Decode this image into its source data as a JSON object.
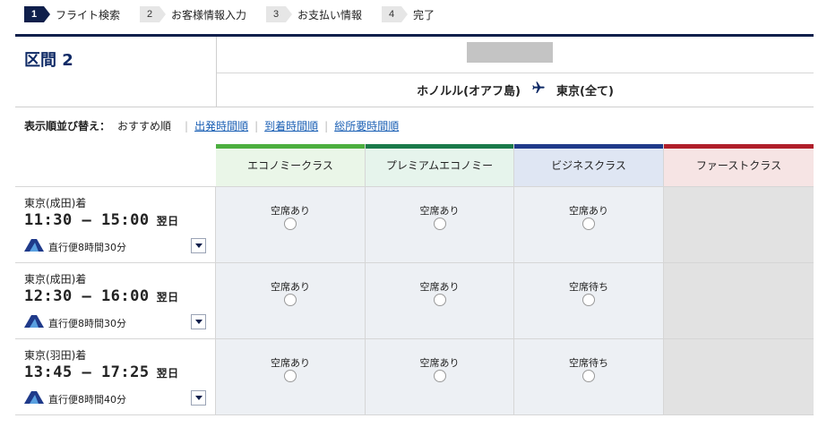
{
  "stepper": [
    {
      "num": "1",
      "label": "フライト検索",
      "active": true
    },
    {
      "num": "2",
      "label": "お客様情報入力",
      "active": false
    },
    {
      "num": "3",
      "label": "お支払い情報",
      "active": false
    },
    {
      "num": "4",
      "label": "完了",
      "active": false
    }
  ],
  "section": {
    "title": "区間 2"
  },
  "route": {
    "origin": "ホノルル(オアフ島)",
    "destination": "東京(全て)",
    "plane_icon": "airplane-icon"
  },
  "sort": {
    "title": "表示順並び替え：",
    "current": "おすすめ順",
    "options": [
      "出発時間順",
      "到着時間順",
      "総所要時間順"
    ]
  },
  "classes": [
    {
      "name": "エコノミークラス",
      "accent": "#4caf3f",
      "bg": "#eaf6e8"
    },
    {
      "name": "プレミアムエコノミー",
      "accent": "#1a7a4a",
      "bg": "#e6f4ec"
    },
    {
      "name": "ビジネスクラス",
      "accent": "#1f3a8a",
      "bg": "#dfe6f3"
    },
    {
      "name": "ファーストクラス",
      "accent": "#b01e2a",
      "bg": "#f6e4e4"
    }
  ],
  "flights": [
    {
      "arrival_airport": "東京(成田)着",
      "depart": "11:30",
      "arrive": "15:00",
      "dash": "—",
      "next_day": "翌日",
      "duration": "直行便8時間30分",
      "availability": [
        "空席あり",
        "空席あり",
        "空席あり",
        ""
      ]
    },
    {
      "arrival_airport": "東京(成田)着",
      "depart": "12:30",
      "arrive": "16:00",
      "dash": "—",
      "next_day": "翌日",
      "duration": "直行便8時間30分",
      "availability": [
        "空席あり",
        "空席あり",
        "空席待ち",
        ""
      ]
    },
    {
      "arrival_airport": "東京(羽田)着",
      "depart": "13:45",
      "arrive": "17:25",
      "dash": "—",
      "next_day": "翌日",
      "duration": "直行便8時間40分",
      "availability": [
        "空席あり",
        "空席あり",
        "空席待ち",
        ""
      ]
    }
  ]
}
